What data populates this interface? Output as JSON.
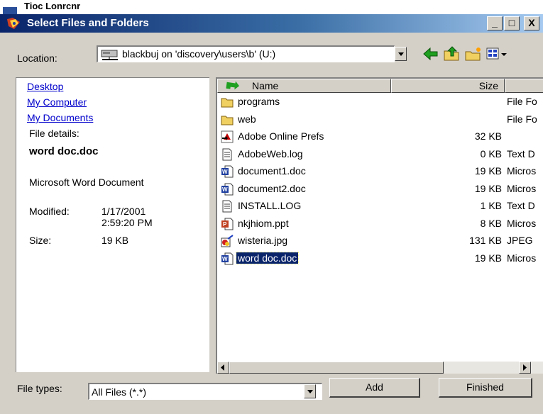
{
  "background_window": {
    "title_fragment": "Tioc Lonrcnr"
  },
  "window": {
    "title": "Select Files and Folders",
    "minimize_label": "_",
    "maximize_label": "□",
    "close_label": "X"
  },
  "location": {
    "label": "Location:",
    "value": "blackbuj on 'discovery\\users\\b' (U:)"
  },
  "left_panel": {
    "links": [
      "Desktop",
      "My Computer",
      "My Documents"
    ],
    "details_heading": "File details:",
    "file_name": "word doc.doc",
    "file_type": "Microsoft Word Document",
    "modified_label": "Modified:",
    "modified_date": "1/17/2001",
    "modified_time": "2:59:20 PM",
    "size_label": "Size:",
    "size_value": "19 KB"
  },
  "file_list": {
    "columns": {
      "name": "Name",
      "size": "Size"
    },
    "rows": [
      {
        "icon": "folder-icon",
        "name": "programs",
        "size": "",
        "type": "File Fo"
      },
      {
        "icon": "folder-icon",
        "name": "web",
        "size": "",
        "type": "File Fo"
      },
      {
        "icon": "shortcut-icon",
        "name": "Adobe Online Prefs",
        "size": "32 KB",
        "type": ""
      },
      {
        "icon": "text-file-icon",
        "name": "AdobeWeb.log",
        "size": "0 KB",
        "type": "Text D"
      },
      {
        "icon": "word-doc-icon",
        "name": "document1.doc",
        "size": "19 KB",
        "type": "Micros"
      },
      {
        "icon": "word-doc-icon",
        "name": "document2.doc",
        "size": "19 KB",
        "type": "Micros"
      },
      {
        "icon": "text-file-icon",
        "name": "INSTALL.LOG",
        "size": "1 KB",
        "type": "Text D"
      },
      {
        "icon": "powerpoint-icon",
        "name": "nkjhiom.ppt",
        "size": "8 KB",
        "type": "Micros"
      },
      {
        "icon": "image-file-icon",
        "name": "wisteria.jpg",
        "size": "131 KB",
        "type": "JPEG"
      },
      {
        "icon": "word-doc-icon",
        "name": "word doc.doc",
        "size": "19 KB",
        "type": "Micros",
        "selected": true
      }
    ]
  },
  "file_types": {
    "label": "File types:",
    "value": "All Files (*.*)"
  },
  "buttons": {
    "add": "Add",
    "finished": "Finished"
  },
  "colors": {
    "title_start": "#0a246a",
    "title_end": "#a6caf0",
    "selection": "#0a246a",
    "link": "#0000cc",
    "chrome": "#d4d0c8"
  }
}
